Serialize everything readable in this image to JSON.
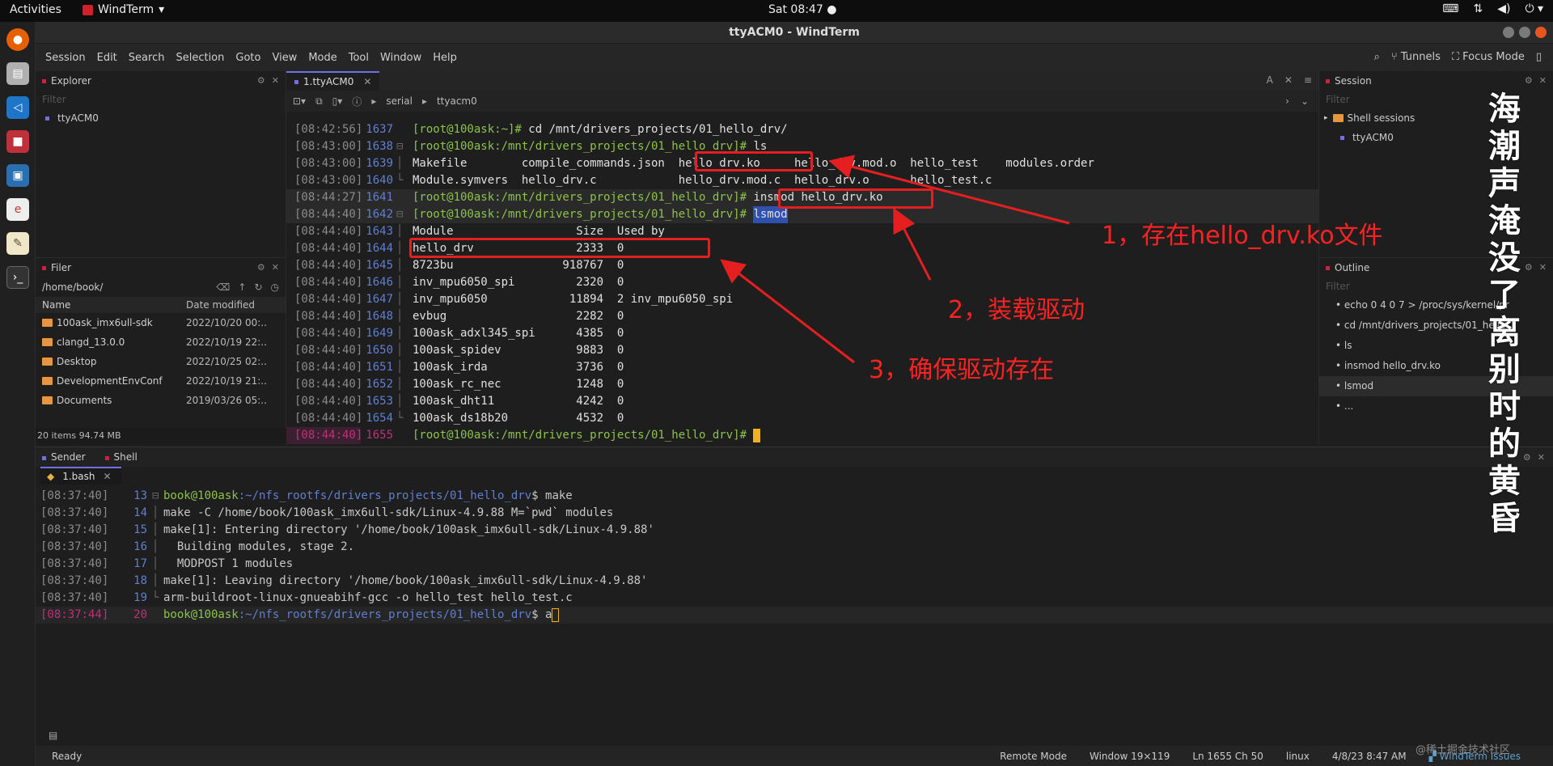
{
  "topbar": {
    "activities": "Activities",
    "app_name": "WindTerm",
    "clock": "Sat 08:47"
  },
  "window": {
    "title": "ttyACM0 - WindTerm"
  },
  "menu": {
    "items": [
      "Session",
      "Edit",
      "Search",
      "Selection",
      "Goto",
      "View",
      "Mode",
      "Tool",
      "Window",
      "Help"
    ],
    "tunnels": "Tunnels",
    "focus_mode": "Focus Mode"
  },
  "explorer": {
    "title": "Explorer",
    "filter_placeholder": "Filter",
    "items": [
      "ttyACM0"
    ]
  },
  "filer": {
    "title": "Filer",
    "path": "/home/book/",
    "col_name": "Name",
    "col_date": "Date modified",
    "rows": [
      {
        "name": "100ask_imx6ull-sdk",
        "date": "2022/10/20 00:.."
      },
      {
        "name": "clangd_13.0.0",
        "date": "2022/10/19 22:.."
      },
      {
        "name": "Desktop",
        "date": "2022/10/25 02:.."
      },
      {
        "name": "DevelopmentEnvConf",
        "date": "2022/10/19 21:.."
      },
      {
        "name": "Documents",
        "date": "2019/03/26 05:.."
      }
    ],
    "summary": "20 items 94.74 MB"
  },
  "terminal": {
    "tab_label": "1.ttyACM0",
    "tab_right": "A",
    "breadcrumb": [
      "serial",
      "ttyacm0"
    ],
    "lines": [
      {
        "ts": "[08:42:56]",
        "ln": "1637",
        "gut": "",
        "prompt": "[root@100ask:~]# ",
        "text": "cd /mnt/drivers_projects/01_hello_drv/"
      },
      {
        "ts": "[08:43:00]",
        "ln": "1638",
        "gut": "⊟",
        "prompt": "[root@100ask:/mnt/drivers_projects/01_hello_drv]# ",
        "text": "ls"
      },
      {
        "ts": "[08:43:00]",
        "ln": "1639",
        "gut": "│",
        "prompt": "",
        "text": "Makefile        compile_commands.json  hello_drv.ko     hello_drv.mod.o  hello_test    modules.order"
      },
      {
        "ts": "[08:43:00]",
        "ln": "1640",
        "gut": "└",
        "prompt": "",
        "text": "Module.symvers  hello_drv.c            hello_drv.mod.c  hello_drv.o      hello_test.c"
      },
      {
        "ts": "[08:44:27]",
        "ln": "1641",
        "gut": "",
        "prompt": "[root@100ask:/mnt/drivers_projects/01_hello_drv]# ",
        "text": "insmod hello_drv.ko"
      },
      {
        "ts": "[08:44:40]",
        "ln": "1642",
        "gut": "⊟",
        "prompt": "[root@100ask:/mnt/drivers_projects/01_hello_drv]# ",
        "text": "lsmod"
      },
      {
        "ts": "[08:44:40]",
        "ln": "1643",
        "gut": "│",
        "prompt": "",
        "text": "Module                  Size  Used by"
      },
      {
        "ts": "[08:44:40]",
        "ln": "1644",
        "gut": "│",
        "prompt": "",
        "text": "hello_drv               2333  0"
      },
      {
        "ts": "[08:44:40]",
        "ln": "1645",
        "gut": "│",
        "prompt": "",
        "text": "8723bu                918767  0"
      },
      {
        "ts": "[08:44:40]",
        "ln": "1646",
        "gut": "│",
        "prompt": "",
        "text": "inv_mpu6050_spi         2320  0"
      },
      {
        "ts": "[08:44:40]",
        "ln": "1647",
        "gut": "│",
        "prompt": "",
        "text": "inv_mpu6050            11894  2 inv_mpu6050_spi"
      },
      {
        "ts": "[08:44:40]",
        "ln": "1648",
        "gut": "│",
        "prompt": "",
        "text": "evbug                   2282  0"
      },
      {
        "ts": "[08:44:40]",
        "ln": "1649",
        "gut": "│",
        "prompt": "",
        "text": "100ask_adxl345_spi      4385  0"
      },
      {
        "ts": "[08:44:40]",
        "ln": "1650",
        "gut": "│",
        "prompt": "",
        "text": "100ask_spidev           9883  0"
      },
      {
        "ts": "[08:44:40]",
        "ln": "1651",
        "gut": "│",
        "prompt": "",
        "text": "100ask_irda             3736  0"
      },
      {
        "ts": "[08:44:40]",
        "ln": "1652",
        "gut": "│",
        "prompt": "",
        "text": "100ask_rc_nec           1248  0"
      },
      {
        "ts": "[08:44:40]",
        "ln": "1653",
        "gut": "│",
        "prompt": "",
        "text": "100ask_dht11            4242  0"
      },
      {
        "ts": "[08:44:40]",
        "ln": "1654",
        "gut": "└",
        "prompt": "",
        "text": "100ask_ds18b20          4532  0"
      },
      {
        "ts": "[08:44:40]",
        "ln": "1655",
        "gut": "",
        "prompt": "[root@100ask:/mnt/drivers_projects/01_hello_drv]# ",
        "text": ""
      }
    ]
  },
  "session_panel": {
    "title": "Session",
    "filter_placeholder": "Filter",
    "group": "Shell sessions",
    "item": "ttyACM0"
  },
  "outline_panel": {
    "title": "Outline",
    "filter_placeholder": "Filter",
    "items": [
      "echo 0 4 0 7 > /proc/sys/kernel/pr",
      "cd /mnt/drivers_projects/01_hello_",
      "ls",
      "insmod hello_drv.ko",
      "lsmod",
      "..."
    ]
  },
  "bottom": {
    "tab_sender": "Sender",
    "tab_shell": "Shell",
    "shell_tab": "1.bash",
    "lines": [
      {
        "ts": "[08:37:40]",
        "ln": "13",
        "gut": "⊟",
        "kind": "prompt",
        "user": "book@100ask",
        "path": ":~/nfs_rootfs/drivers_projects/01_hello_drv",
        "cmd": "$ make"
      },
      {
        "ts": "[08:37:40]",
        "ln": "14",
        "gut": "│",
        "kind": "make",
        "text": "make -C /home/book/100ask_imx6ull-sdk/Linux-4.9.88 M=`pwd` modules"
      },
      {
        "ts": "[08:37:40]",
        "ln": "15",
        "gut": "│",
        "kind": "text",
        "text": "make[1]: Entering directory '/home/book/100ask_imx6ull-sdk/Linux-4.9.88'"
      },
      {
        "ts": "[08:37:40]",
        "ln": "16",
        "gut": "│",
        "kind": "text",
        "text": "  Building modules, stage 2."
      },
      {
        "ts": "[08:37:40]",
        "ln": "17",
        "gut": "│",
        "kind": "text",
        "text": "  MODPOST 1 modules"
      },
      {
        "ts": "[08:37:40]",
        "ln": "18",
        "gut": "│",
        "kind": "text",
        "text": "make[1]: Leaving directory '/home/book/100ask_imx6ull-sdk/Linux-4.9.88'"
      },
      {
        "ts": "[08:37:40]",
        "ln": "19",
        "gut": "└",
        "kind": "gcc",
        "text": "arm-buildroot-linux-gnueabihf-gcc -o hello_test hello_test.c"
      },
      {
        "ts": "[08:37:44]",
        "ln": "20",
        "gut": "",
        "kind": "prompt",
        "user": "book@100ask",
        "path": ":~/nfs_rootfs/drivers_projects/01_hello_drv",
        "cmd": "$ a"
      }
    ]
  },
  "status": {
    "ready": "Ready",
    "remote_mode": "Remote Mode",
    "window": "Window 19×119",
    "cursor": "Ln 1655 Ch 50",
    "os": "linux",
    "datetime": "4/8/23 8:47 AM",
    "issues": "WindTerm Issues"
  },
  "annotations": {
    "a1": "1，存在hello_drv.ko文件",
    "a2": "2，装载驱动",
    "a3": "3，确保驱动存在"
  },
  "vertical_text": "海潮声 淹没了离别时的黄昏",
  "watermark": "@稀土掘金技术社区"
}
